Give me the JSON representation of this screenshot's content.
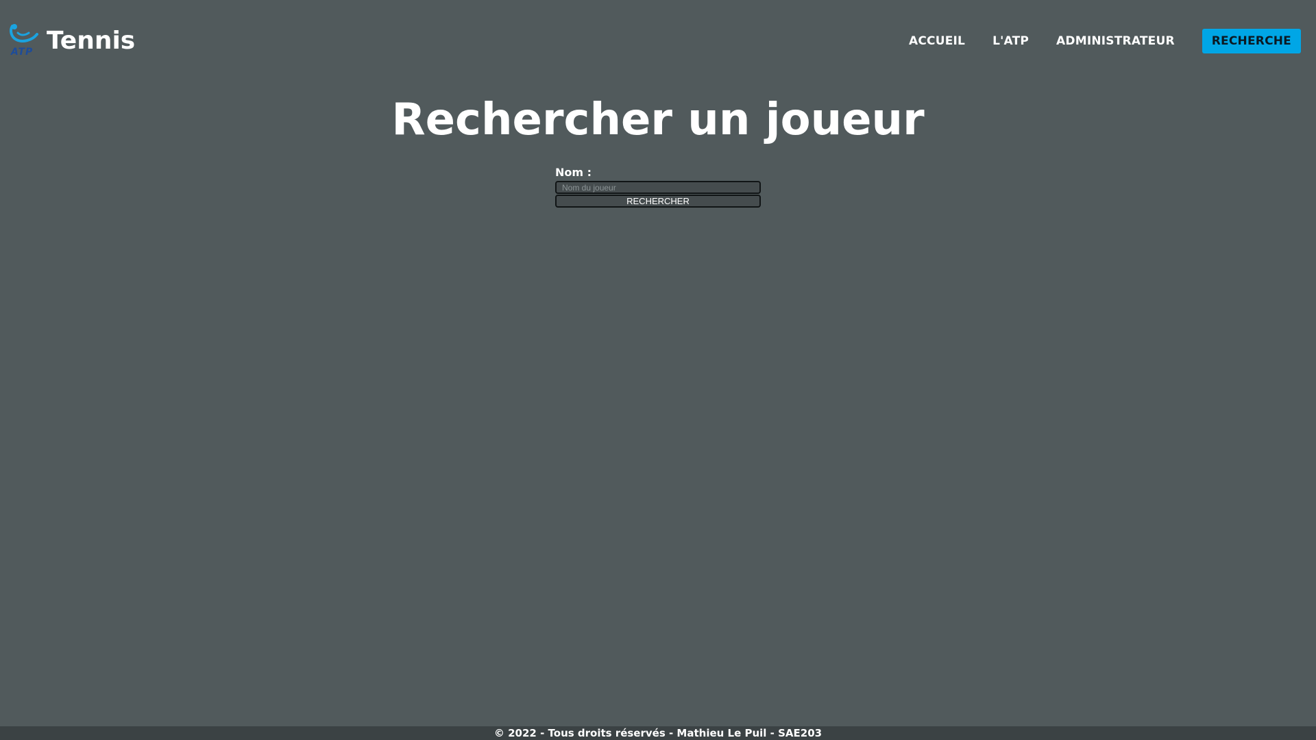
{
  "header": {
    "logo_text": "ATP",
    "site_title": "Tennis"
  },
  "nav": {
    "items": [
      {
        "label": "ACCUEIL"
      },
      {
        "label": "L'ATP"
      },
      {
        "label": "ADMINISTRATEUR"
      },
      {
        "label": "RECHERCHE",
        "active": true
      }
    ]
  },
  "main": {
    "title": "Rechercher un joueur",
    "form": {
      "name_label": "Nom :",
      "name_placeholder": "Nom du joueur",
      "name_value": "",
      "submit_label": "RECHERCHER"
    }
  },
  "footer": {
    "text": "© 2022 - Tous droits réservés - Mathieu Le Puil - SAE203"
  },
  "colors": {
    "background": "#515a5c",
    "accent": "#00a6e6",
    "footer_bg": "#3b4244",
    "logo_blue": "#1d4c9a"
  }
}
